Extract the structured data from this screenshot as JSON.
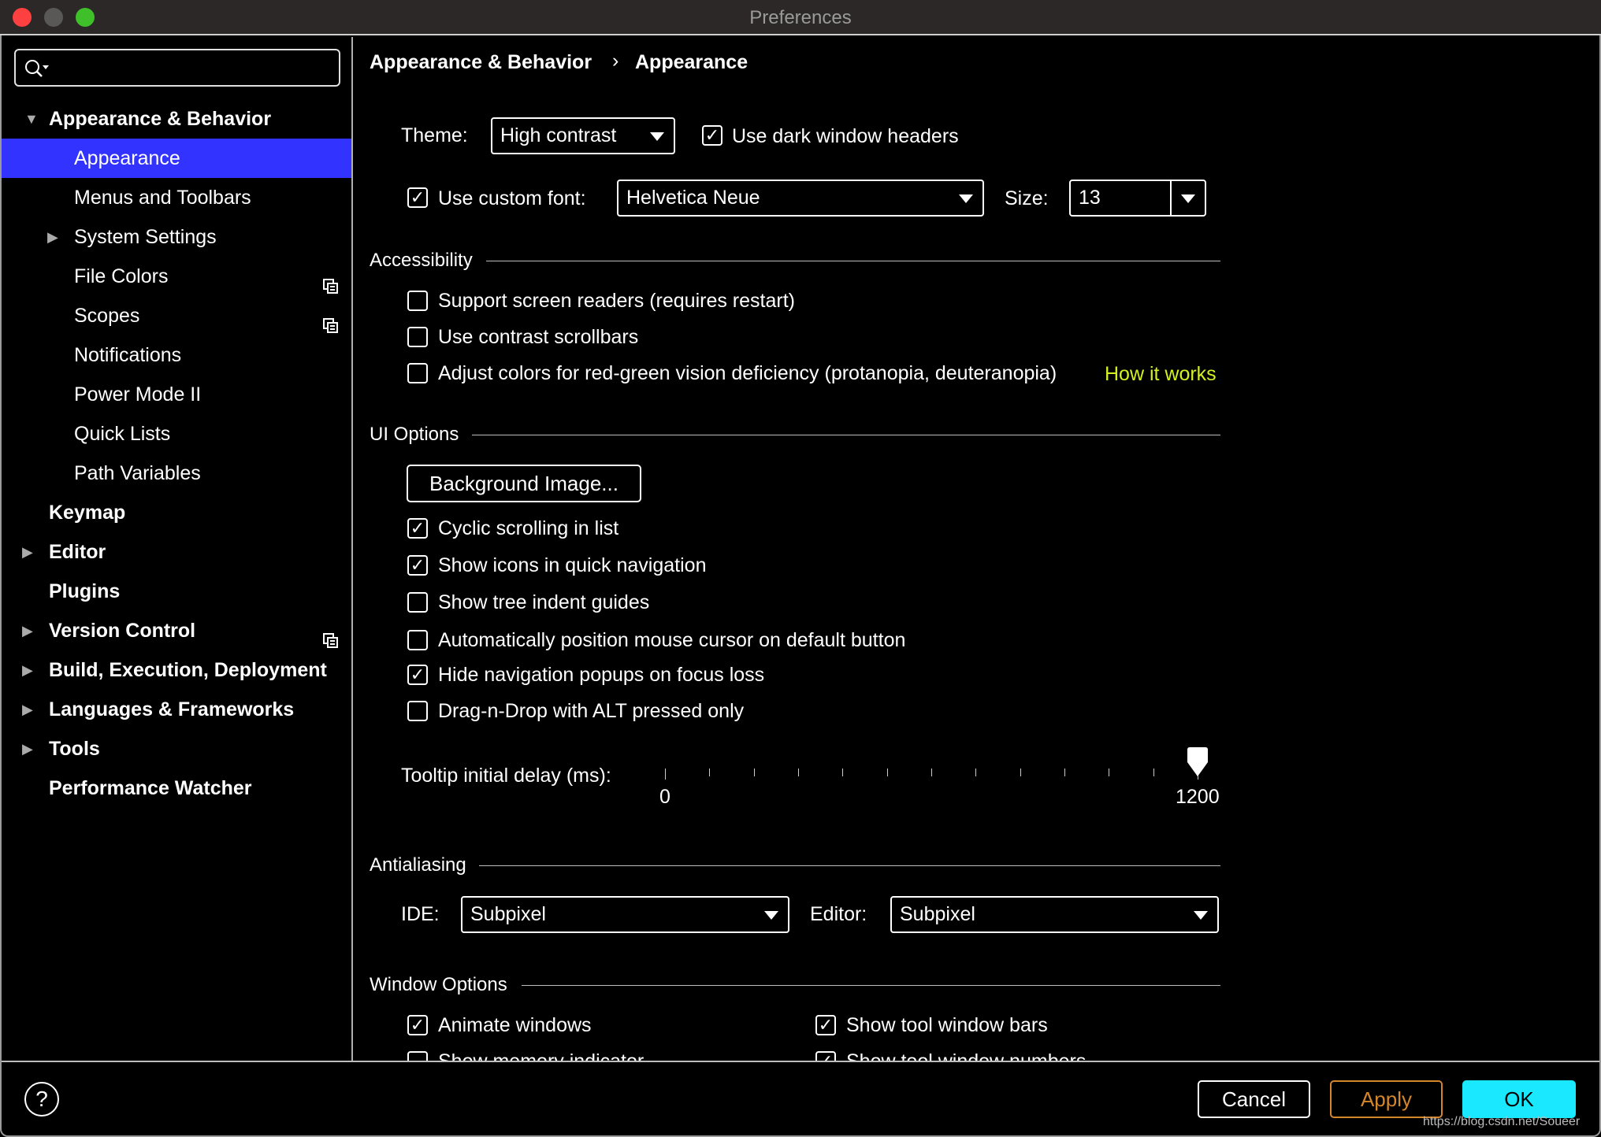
{
  "window": {
    "title": "Preferences",
    "controls": {
      "close": "#ff4040",
      "minimize": "#5a5757",
      "maximize": "#3fbf2a"
    }
  },
  "sidebar": {
    "search": {
      "placeholder": "",
      "icon": "search-icon"
    },
    "items": [
      {
        "label": "Appearance & Behavior",
        "level": 0,
        "bold": true,
        "expanded": true
      },
      {
        "label": "Appearance",
        "level": 1,
        "selected": true
      },
      {
        "label": "Menus and Toolbars",
        "level": 1
      },
      {
        "label": "System Settings",
        "level": 1,
        "expandable": true
      },
      {
        "label": "File Colors",
        "level": 1,
        "copy_icon": true
      },
      {
        "label": "Scopes",
        "level": 1,
        "copy_icon": true
      },
      {
        "label": "Notifications",
        "level": 1
      },
      {
        "label": "Power Mode II",
        "level": 1
      },
      {
        "label": "Quick Lists",
        "level": 1
      },
      {
        "label": "Path Variables",
        "level": 1
      },
      {
        "label": "Keymap",
        "level": 0,
        "bold": true
      },
      {
        "label": "Editor",
        "level": 0,
        "bold": true,
        "expandable": true
      },
      {
        "label": "Plugins",
        "level": 0,
        "bold": true
      },
      {
        "label": "Version Control",
        "level": 0,
        "bold": true,
        "expandable": true,
        "copy_icon": true
      },
      {
        "label": "Build, Execution, Deployment",
        "level": 0,
        "bold": true,
        "expandable": true
      },
      {
        "label": "Languages & Frameworks",
        "level": 0,
        "bold": true,
        "expandable": true
      },
      {
        "label": "Tools",
        "level": 0,
        "bold": true,
        "expandable": true
      },
      {
        "label": "Performance Watcher",
        "level": 0,
        "bold": true
      }
    ],
    "selected_color": "#3333ff"
  },
  "breadcrumb": {
    "parent": "Appearance & Behavior",
    "separator": "›",
    "current": "Appearance"
  },
  "theme": {
    "label": "Theme:",
    "value": "High contrast",
    "dark_headers": {
      "label": "Use dark window headers",
      "checked": true
    }
  },
  "font": {
    "custom": {
      "label": "Use custom font:",
      "checked": true
    },
    "value": "Helvetica Neue",
    "size_label": "Size:",
    "size": "13"
  },
  "accessibility": {
    "header": "Accessibility",
    "options": [
      {
        "label": "Support screen readers (requires restart)",
        "checked": false
      },
      {
        "label": "Use contrast scrollbars",
        "checked": false
      },
      {
        "label": "Adjust colors for red-green vision deficiency (protanopia, deuteranopia)",
        "checked": false
      }
    ],
    "link": "How it works",
    "link_color": "#d4f020"
  },
  "ui_options": {
    "header": "UI Options",
    "background_button": "Background Image...",
    "options": [
      {
        "label": "Cyclic scrolling in list",
        "checked": true
      },
      {
        "label": "Show icons in quick navigation",
        "checked": true
      },
      {
        "label": "Show tree indent guides",
        "checked": false
      },
      {
        "label": "Automatically position mouse cursor on default button",
        "checked": false
      },
      {
        "label": "Hide navigation popups on focus loss",
        "checked": true
      },
      {
        "label": "Drag-n-Drop with ALT pressed only",
        "checked": false
      }
    ],
    "tooltip": {
      "label": "Tooltip initial delay (ms):",
      "min": "0",
      "max": "1200",
      "value": 1200
    }
  },
  "antialiasing": {
    "header": "Antialiasing",
    "ide_label": "IDE:",
    "ide": "Subpixel",
    "editor_label": "Editor:",
    "editor": "Subpixel"
  },
  "window_options": {
    "header": "Window Options",
    "options": [
      {
        "label": "Animate windows",
        "checked": true
      },
      {
        "label": "Show tool window bars",
        "checked": true
      },
      {
        "label": "Show memory indicator",
        "checked": false
      },
      {
        "label": "Show tool window numbers",
        "checked": true
      }
    ]
  },
  "footer": {
    "help": "?",
    "cancel": "Cancel",
    "apply": "Apply",
    "ok": "OK",
    "apply_color": "#d4862a",
    "ok_color": "#1ae8ff",
    "watermark": "https://blog.csdn.net/Soueer"
  },
  "check_glyph": "✓"
}
